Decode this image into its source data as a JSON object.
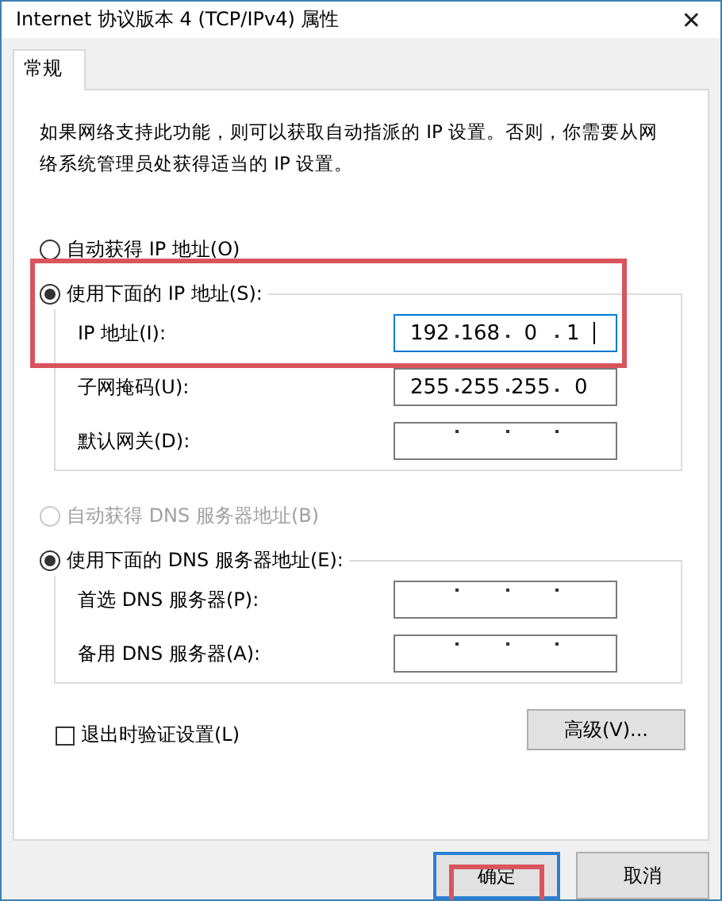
{
  "window": {
    "title": "Internet 协议版本 4 (TCP/IPv4) 属性",
    "close_glyph": "✕"
  },
  "tabs": [
    {
      "label": "常规",
      "selected": true
    }
  ],
  "description": "如果网络支持此功能，则可以获取自动指派的 IP 设置。否则，你需要从网络系统管理员处获得适当的 IP 设置。",
  "ip_auto": {
    "label": "自动获得 IP 地址(O)",
    "selected": false,
    "disabled": false
  },
  "ip_manual": {
    "label": "使用下面的 IP 地址(S):",
    "selected": true,
    "highlighted": true,
    "fields": [
      {
        "label": "IP 地址(I):",
        "octets": [
          "192",
          "168",
          "0",
          "1"
        ],
        "focused": true
      },
      {
        "label": "子网掩码(U):",
        "octets": [
          "255",
          "255",
          "255",
          "0"
        ],
        "focused": false
      },
      {
        "label": "默认网关(D):",
        "focused": false
      }
    ]
  },
  "dns_auto": {
    "label": "自动获得 DNS 服务器地址(B)",
    "selected": false,
    "disabled": true
  },
  "dns_manual": {
    "label": "使用下面的 DNS 服务器地址(E):",
    "selected": true,
    "fields": [
      {
        "label": "首选 DNS 服务器(P):",
        "focused": false
      },
      {
        "label": "备用 DNS 服务器(A):",
        "focused": false
      }
    ]
  },
  "validate": {
    "label": "退出时验证设置(L)",
    "checked": false
  },
  "advanced_button": "高级(V)...",
  "buttons": [
    {
      "label": "确定",
      "default": true,
      "highlighted": true
    },
    {
      "label": "取消",
      "default": false,
      "highlighted": false
    }
  ]
}
